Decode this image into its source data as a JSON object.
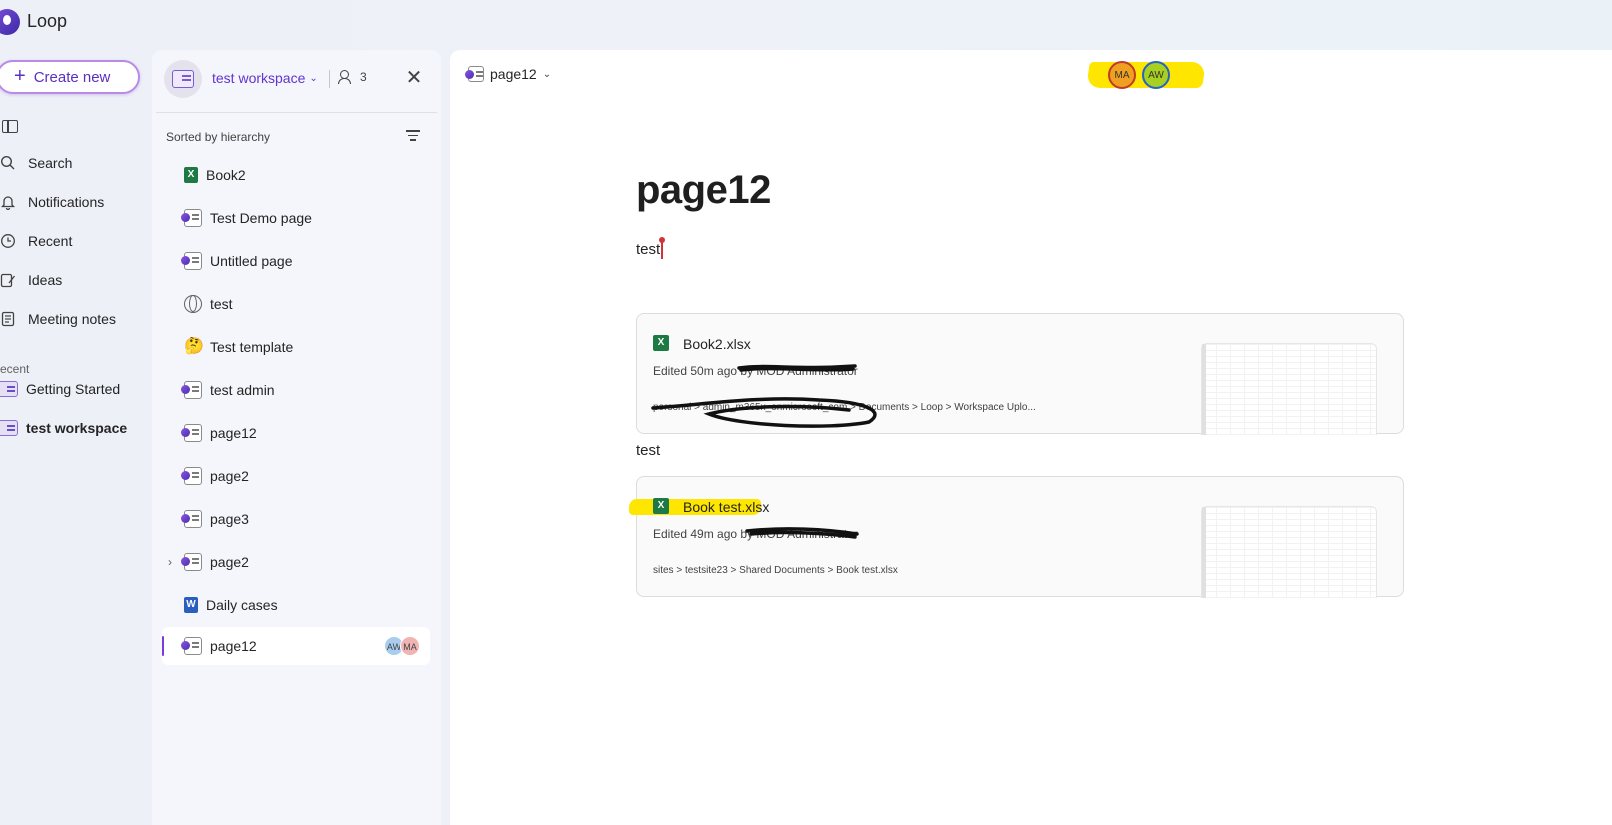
{
  "app": {
    "name": "Loop"
  },
  "nav": {
    "create_label": "Create new",
    "items": [
      {
        "label": "Search",
        "icon": "search-icon"
      },
      {
        "label": "Notifications",
        "icon": "bell-icon"
      },
      {
        "label": "Recent",
        "icon": "clock-icon"
      },
      {
        "label": "Ideas",
        "icon": "lightbulb-icon"
      },
      {
        "label": "Meeting notes",
        "icon": "notes-icon"
      }
    ],
    "recent_heading": "ecent",
    "recent": [
      {
        "label": "Getting Started"
      },
      {
        "label": "test workspace"
      }
    ]
  },
  "workspace": {
    "name": "test workspace",
    "member_count": "3",
    "sort_label": "Sorted by hierarchy",
    "items": [
      {
        "label": "Book2",
        "type": "excel"
      },
      {
        "label": "Test Demo page",
        "type": "loop"
      },
      {
        "label": "Untitled page",
        "type": "loop"
      },
      {
        "label": "test",
        "type": "web"
      },
      {
        "label": "Test template",
        "type": "emoji",
        "emoji": "🤔"
      },
      {
        "label": "test admin",
        "type": "loop"
      },
      {
        "label": "page12",
        "type": "loop"
      },
      {
        "label": "page2",
        "type": "loop"
      },
      {
        "label": "page3",
        "type": "loop"
      },
      {
        "label": "page2",
        "type": "loop",
        "expandable": true
      },
      {
        "label": "Daily cases",
        "type": "word"
      },
      {
        "label": "page12",
        "type": "loop",
        "selected": true,
        "avatars": [
          "AW",
          "MA"
        ]
      }
    ]
  },
  "page": {
    "breadcrumb": "page12",
    "presence": [
      {
        "initials": "MA",
        "color": "#f0a020",
        "ring": "#c0392b"
      },
      {
        "initials": "AW",
        "color": "#a8d020",
        "ring": "#2563c7"
      }
    ],
    "title": "page12",
    "text1": "test",
    "text2": "test",
    "cards": [
      {
        "icon_letter": "X",
        "title": "Book2.xlsx",
        "meta": "Edited 50m ago by MOD Administrator",
        "path": "personal > admin_m365x_onmicrosoft_com > Documents > Loop > Workspace Uplo..."
      },
      {
        "icon_letter": "X",
        "title": "Book test.xlsx",
        "meta": "Edited 49m ago by MOD Administrator",
        "path": "sites > testsite23 > Shared Documents > Book test.xlsx"
      }
    ]
  },
  "colors": {
    "accent": "#6234d0",
    "highlight": "#ffe600",
    "excel": "#1d7a45",
    "word": "#2b5fbf"
  }
}
